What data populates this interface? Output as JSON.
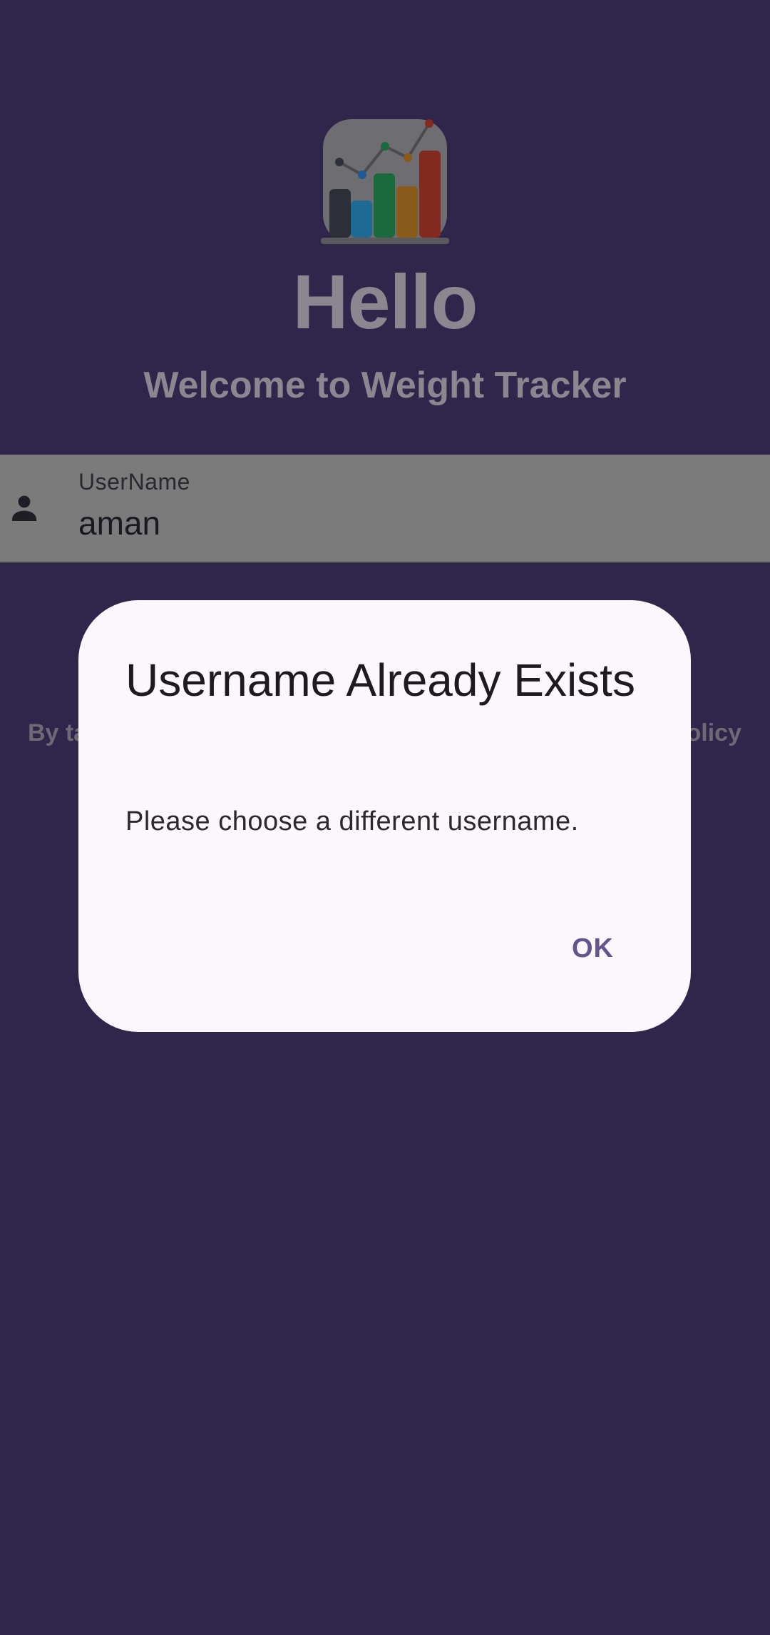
{
  "colors": {
    "background": "#30264b",
    "dialog_surface": "#fcf7fc",
    "accent": "#65558f"
  },
  "header": {
    "logo_icon": "bar-chart-icon",
    "title": "Hello",
    "subtitle": "Welcome to Weight Tracker"
  },
  "username_field": {
    "icon": "person-icon",
    "label": "UserName",
    "value": "aman"
  },
  "terms": {
    "left_visible": "By ta",
    "right_visible": "olicy"
  },
  "dialog": {
    "title": "Username Already Exists",
    "message": "Please choose a different username.",
    "ok_label": "OK"
  }
}
